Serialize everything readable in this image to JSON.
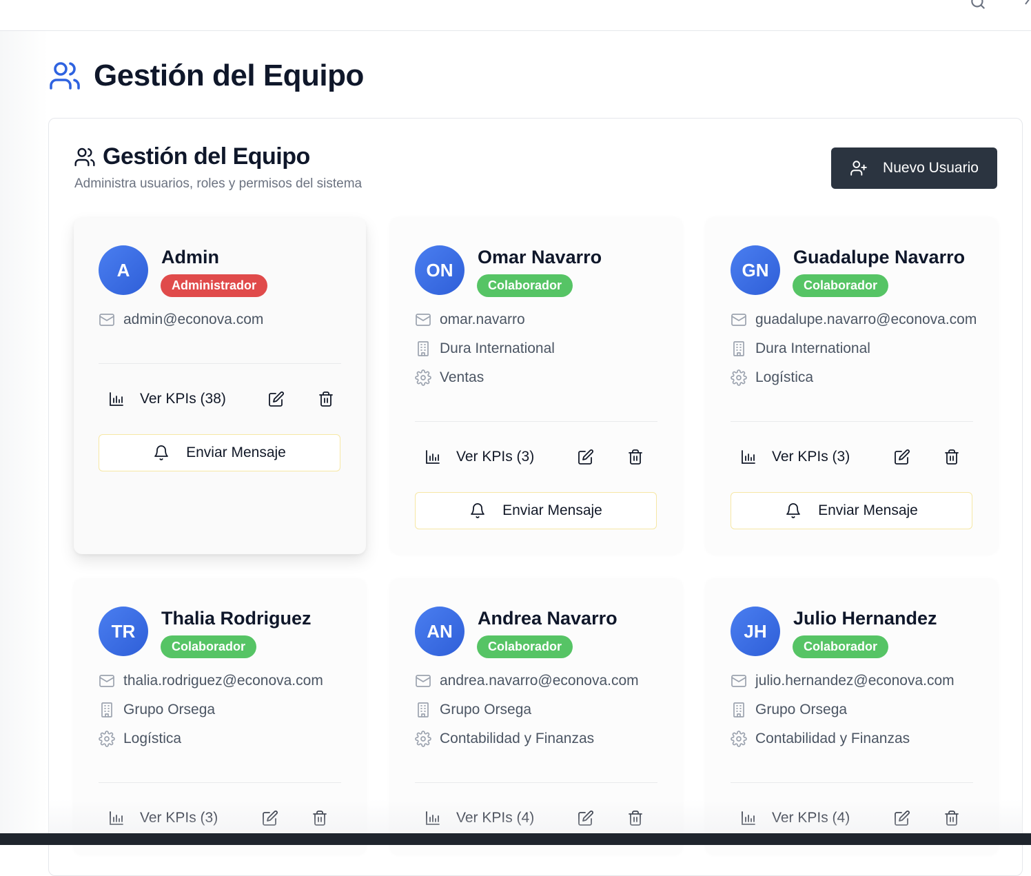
{
  "page": {
    "title": "Gestión del Equipo"
  },
  "panel": {
    "title": "Gestión del Equipo",
    "subtitle": "Administra usuarios, roles y permisos del sistema",
    "new_user_label": "Nuevo Usuario"
  },
  "colors": {
    "accent_blue": "#3b6fe3",
    "dark_button": "#2b3440",
    "admin_badge": "#e04b4b",
    "collab_badge": "#56c465"
  },
  "actions": {
    "send_message_label": "Enviar Mensaje"
  },
  "users": [
    {
      "initials": "A",
      "name": "Admin",
      "role": "Administrador",
      "email": "admin@econova.com",
      "company": "",
      "area": "",
      "kpi_label": "Ver KPIs (38)"
    },
    {
      "initials": "ON",
      "name": "Omar Navarro",
      "role": "Colaborador",
      "email": "omar.navarro",
      "company": "Dura International",
      "area": "Ventas",
      "kpi_label": "Ver KPIs (3)"
    },
    {
      "initials": "GN",
      "name": "Guadalupe Navarro",
      "role": "Colaborador",
      "email": "guadalupe.navarro@econova.com",
      "company": "Dura International",
      "area": "Logística",
      "kpi_label": "Ver KPIs (3)"
    },
    {
      "initials": "TR",
      "name": "Thalia Rodriguez",
      "role": "Colaborador",
      "email": "thalia.rodriguez@econova.com",
      "company": "Grupo Orsega",
      "area": "Logística",
      "kpi_label": "Ver KPIs (3)"
    },
    {
      "initials": "AN",
      "name": "Andrea Navarro",
      "role": "Colaborador",
      "email": "andrea.navarro@econova.com",
      "company": "Grupo Orsega",
      "area": "Contabilidad y Finanzas",
      "kpi_label": "Ver KPIs (4)"
    },
    {
      "initials": "JH",
      "name": "Julio Hernandez",
      "role": "Colaborador",
      "email": "julio.hernandez@econova.com",
      "company": "Grupo Orsega",
      "area": "Contabilidad y Finanzas",
      "kpi_label": "Ver KPIs (4)"
    }
  ]
}
